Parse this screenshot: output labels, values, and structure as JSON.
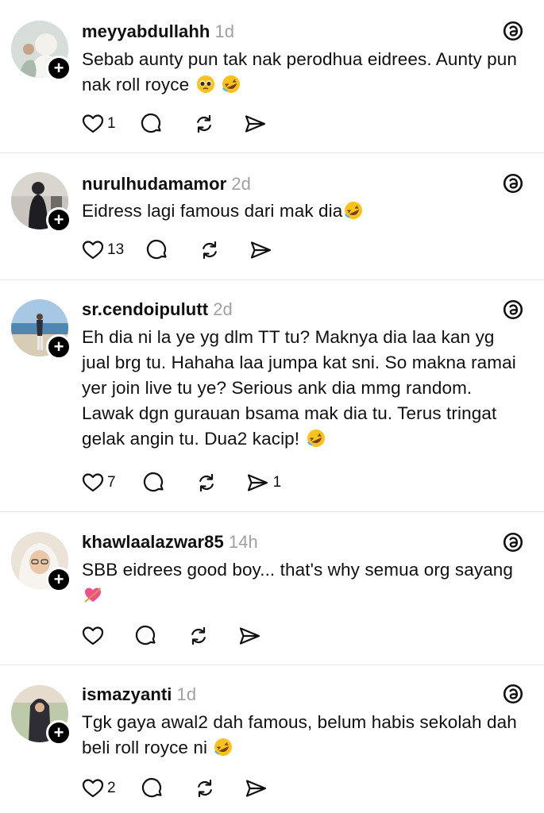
{
  "posts": [
    {
      "username": "meyyabdullahh",
      "time": "1d",
      "text": "Sebab aunty pun tak nak perodhua eidrees. Aunty pun nak roll royce",
      "emojis": [
        "pleading-face-emoji",
        "rolling-laughing-emoji"
      ],
      "likes": "1",
      "reposts": "",
      "shares": "",
      "avatar_colors": [
        "#cfd6d2",
        "#f1f0ec",
        "#9fb3a6"
      ]
    },
    {
      "username": "nurulhudamamor",
      "time": "2d",
      "text": "Eidress lagi famous dari mak dia",
      "emojis": [
        "rolling-laughing-emoji"
      ],
      "likes": "13",
      "reposts": "",
      "shares": "",
      "avatar_colors": [
        "#c9c4bd",
        "#1f1f22",
        "#8d8a84"
      ]
    },
    {
      "username": "sr.cendoipulutt",
      "time": "2d",
      "text": "Eh dia ni la ye yg dlm TT tu? Maknya dia laa kan yg jual brg tu. Hahaha laa jumpa kat sni. So makna ramai yer join live tu ye? Serious ank dia mmg random. Lawak dgn gurauan bsama mak dia tu. Terus tringat gelak angin tu. Dua2 kacip!",
      "emojis": [
        "rolling-laughing-emoji"
      ],
      "likes": "7",
      "reposts": "",
      "shares": "1",
      "avatar_colors": [
        "#9fc3e1",
        "#5f94bb",
        "#d8cbb3"
      ]
    },
    {
      "username": "khawlaalazwar85",
      "time": "14h",
      "text": "SBB eidrees good boy... that's why semua org sayang",
      "emojis": [
        "heart-with-arrow-emoji"
      ],
      "likes": "",
      "reposts": "",
      "shares": "",
      "avatar_colors": [
        "#e8dfd2",
        "#f6f2ec",
        "#b8b8b8"
      ]
    },
    {
      "username": "ismazyanti",
      "time": "1d",
      "text": "Tgk gaya awal2 dah famous, belum habis sekolah dah beli roll royce ni",
      "emojis": [
        "rolling-laughing-emoji"
      ],
      "likes": "2",
      "reposts": "",
      "shares": "",
      "avatar_colors": [
        "#b7c7a4",
        "#2d2d33",
        "#e4d7c6"
      ]
    }
  ],
  "accent": "#101010",
  "muted": "#a0a0a0"
}
